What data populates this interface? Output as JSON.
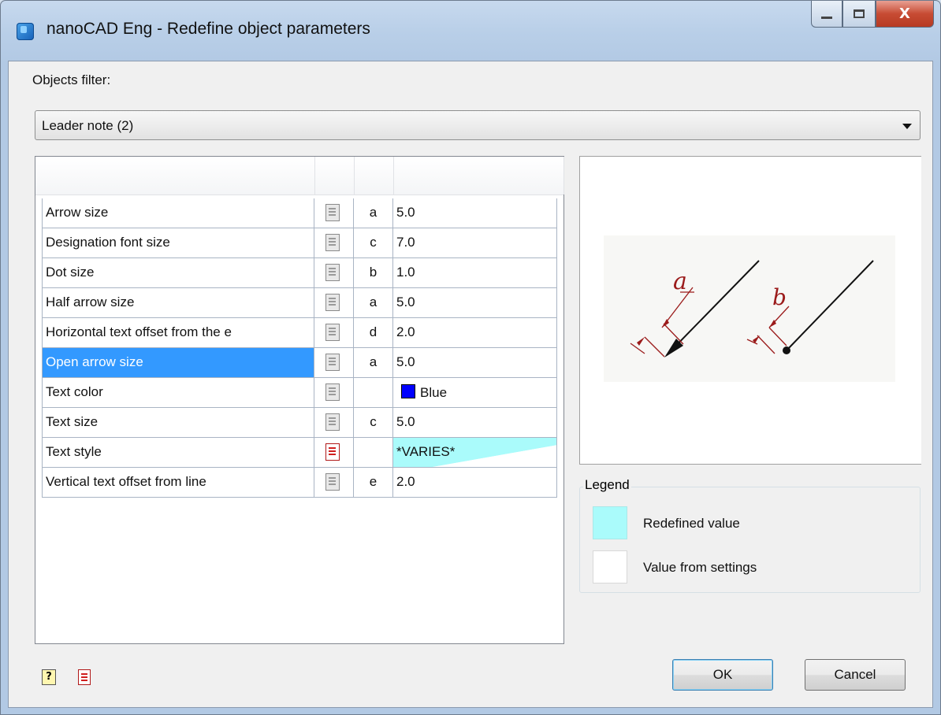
{
  "window": {
    "title": "nanoCAD Eng - Redefine object parameters",
    "close_glyph": "X"
  },
  "filter": {
    "label": "Objects filter:",
    "value": "Leader note (2)"
  },
  "grid": {
    "rows": [
      {
        "name": "Arrow size",
        "symbol": "a",
        "value": "5.0"
      },
      {
        "name": "Designation font size",
        "symbol": "c",
        "value": "7.0"
      },
      {
        "name": "Dot size",
        "symbol": "b",
        "value": "1.0"
      },
      {
        "name": "Half arrow size",
        "symbol": "a",
        "value": "5.0"
      },
      {
        "name": "Horizontal text offset from the e",
        "symbol": "d",
        "value": "2.0"
      },
      {
        "name": "Open arrow size",
        "symbol": "a",
        "value": "5.0",
        "selected": true
      },
      {
        "name": "Text color",
        "symbol": "",
        "value": "Blue",
        "color": "#0000ff"
      },
      {
        "name": "Text size",
        "symbol": "c",
        "value": "5.0"
      },
      {
        "name": "Text style",
        "symbol": "",
        "value": "*VARIES*",
        "redefined": true
      },
      {
        "name": "Vertical text offset from line",
        "symbol": "e",
        "value": "2.0"
      }
    ]
  },
  "preview": {
    "label_a": "a",
    "label_b": "b"
  },
  "legend": {
    "title": "Legend",
    "redefined_label": "Redefined value",
    "redefined_color": "#aafbfb",
    "settings_label": "Value from settings",
    "settings_color": "#ffffff"
  },
  "buttons": {
    "ok": "OK",
    "cancel": "Cancel"
  },
  "footer": {
    "help_glyph": "?"
  },
  "colors": {
    "selection": "#3399ff",
    "dimension_red": "#9b1b1b"
  }
}
